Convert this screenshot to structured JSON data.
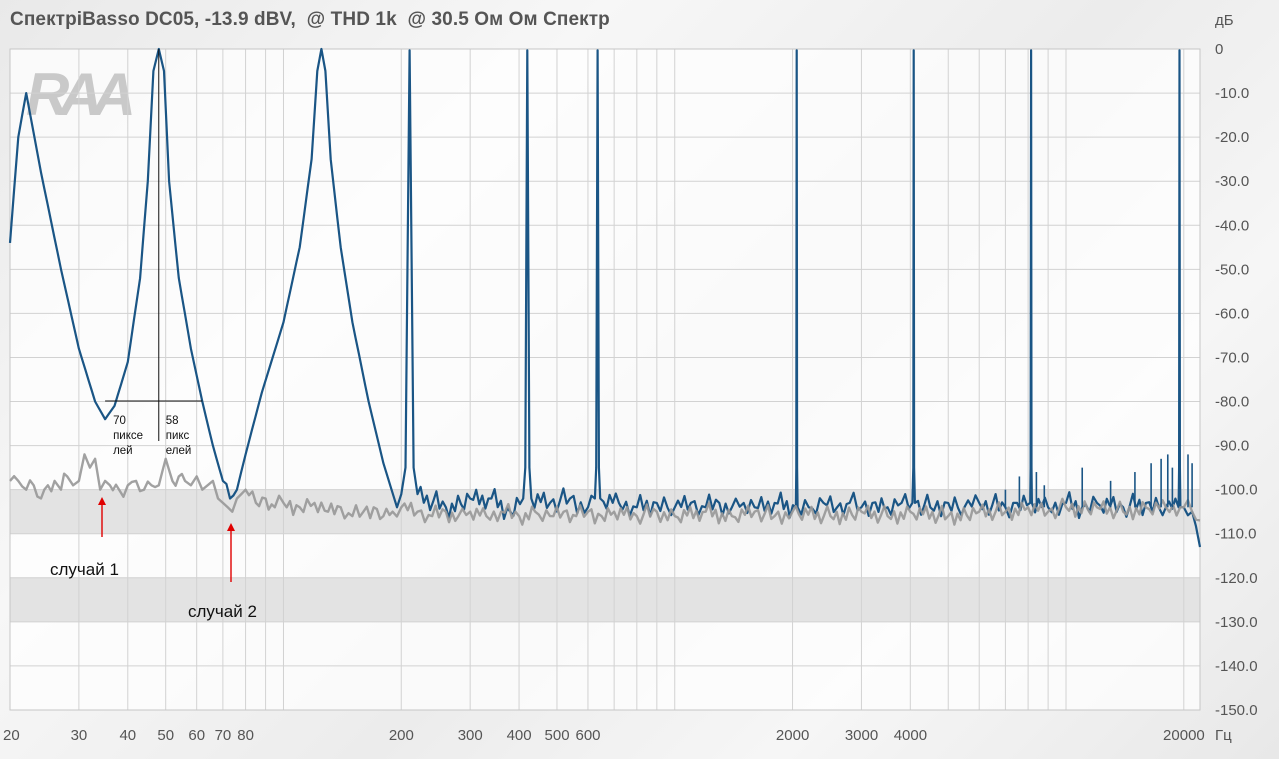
{
  "chart_data": {
    "type": "line",
    "title": "СпектрiBasso DC05, -13.9 dBV,  @ THD 1k  @ 30.5 Ом Ом Спектр",
    "xlabel": "Гц",
    "ylabel": "дБ",
    "x_scale": "log",
    "xlim": [
      20,
      22000
    ],
    "ylim": [
      -150,
      0
    ],
    "x_ticks": [
      {
        "value": 20,
        "label": "20"
      },
      {
        "value": 30,
        "label": "30"
      },
      {
        "value": 40,
        "label": "40"
      },
      {
        "value": 50,
        "label": "50"
      },
      {
        "value": 60,
        "label": "60"
      },
      {
        "value": 70,
        "label": "70"
      },
      {
        "value": 80,
        "label": "80"
      },
      {
        "value": 200,
        "label": "200"
      },
      {
        "value": 300,
        "label": "300"
      },
      {
        "value": 400,
        "label": "400"
      },
      {
        "value": 500,
        "label": "500"
      },
      {
        "value": 600,
        "label": "600"
      },
      {
        "value": 2000,
        "label": "2000"
      },
      {
        "value": 3000,
        "label": "3000"
      },
      {
        "value": 4000,
        "label": "4000"
      },
      {
        "value": 20000,
        "label": "20000"
      }
    ],
    "y_ticks": [
      {
        "value": 0,
        "label": "0"
      },
      {
        "value": -10,
        "label": "-10.0"
      },
      {
        "value": -20,
        "label": "-20.0"
      },
      {
        "value": -30,
        "label": "-30.0"
      },
      {
        "value": -40,
        "label": "-40.0"
      },
      {
        "value": -50,
        "label": "-50.0"
      },
      {
        "value": -60,
        "label": "-60.0"
      },
      {
        "value": -70,
        "label": "-70.0"
      },
      {
        "value": -80,
        "label": "-80.0"
      },
      {
        "value": -90,
        "label": "-90.0"
      },
      {
        "value": -100,
        "label": "-100.0"
      },
      {
        "value": -110,
        "label": "-110.0"
      },
      {
        "value": -120,
        "label": "-120.0"
      },
      {
        "value": -130,
        "label": "-130.0"
      },
      {
        "value": -140,
        "label": "-140.0"
      },
      {
        "value": -150,
        "label": "-150.0"
      }
    ],
    "grid": true,
    "shaded_bands": [
      [
        -110,
        -100
      ],
      [
        -130,
        -120
      ]
    ],
    "series": [
      {
        "color": "#1a5585",
        "points": [
          [
            20,
            -44
          ],
          [
            21,
            -20
          ],
          [
            22,
            -10
          ],
          [
            24,
            -28
          ],
          [
            27,
            -50
          ],
          [
            30,
            -68
          ],
          [
            33,
            -80
          ],
          [
            35,
            -84
          ],
          [
            37,
            -81
          ],
          [
            40,
            -71
          ],
          [
            43,
            -52
          ],
          [
            45,
            -30
          ],
          [
            46.5,
            -5
          ],
          [
            48,
            0
          ],
          [
            49.5,
            -5
          ],
          [
            51,
            -30
          ],
          [
            54,
            -52
          ],
          [
            58,
            -68
          ],
          [
            62,
            -80
          ],
          [
            66,
            -90
          ],
          [
            70,
            -98
          ],
          [
            73,
            -102
          ],
          [
            76,
            -100
          ],
          [
            80,
            -92
          ],
          [
            88,
            -78
          ],
          [
            100,
            -62
          ],
          [
            110,
            -45
          ],
          [
            118,
            -25
          ],
          [
            122,
            -5
          ],
          [
            125,
            0
          ],
          [
            128,
            -5
          ],
          [
            132,
            -25
          ],
          [
            140,
            -45
          ],
          [
            150,
            -62
          ],
          [
            165,
            -80
          ],
          [
            180,
            -94
          ],
          [
            195,
            -104
          ],
          [
            200,
            -101
          ],
          [
            205,
            -95
          ],
          [
            210,
            -0.3
          ],
          [
            215,
            -95
          ],
          [
            220,
            -101
          ],
          [
            260,
            -104
          ],
          [
            300,
            -102
          ],
          [
            340,
            -102
          ],
          [
            380,
            -105
          ],
          [
            410,
            -102
          ],
          [
            415,
            -95
          ],
          [
            420,
            -0.3
          ],
          [
            425,
            -95
          ],
          [
            430,
            -102
          ],
          [
            480,
            -103
          ],
          [
            540,
            -102
          ],
          [
            600,
            -104
          ],
          [
            625,
            -102
          ],
          [
            630,
            -95
          ],
          [
            635,
            -0.3
          ],
          [
            640,
            -95
          ],
          [
            645,
            -102
          ],
          [
            720,
            -103
          ],
          [
            800,
            -104
          ],
          [
            900,
            -103
          ],
          [
            1000,
            -104
          ],
          [
            1100,
            -103
          ],
          [
            1200,
            -104
          ],
          [
            1300,
            -103
          ],
          [
            1400,
            -104
          ],
          [
            1500,
            -103
          ],
          [
            1600,
            -104
          ],
          [
            1800,
            -103
          ],
          [
            2040,
            -104
          ],
          [
            2045,
            -95
          ],
          [
            2050,
            -0.3
          ],
          [
            2055,
            -95
          ],
          [
            2060,
            -104
          ],
          [
            2200,
            -104
          ],
          [
            2400,
            -103
          ],
          [
            2600,
            -104
          ],
          [
            2800,
            -103
          ],
          [
            3000,
            -104
          ],
          [
            3200,
            -103
          ],
          [
            3500,
            -104
          ],
          [
            3800,
            -103
          ],
          [
            4050,
            -103
          ],
          [
            4070,
            -95
          ],
          [
            4080,
            -0.3
          ],
          [
            4090,
            -95
          ],
          [
            4110,
            -103
          ],
          [
            4500,
            -104
          ],
          [
            5000,
            -103
          ],
          [
            5500,
            -104
          ],
          [
            6000,
            -103
          ],
          [
            7000,
            -104
          ],
          [
            7500,
            -103
          ],
          [
            8100,
            -103
          ],
          [
            8120,
            -95
          ],
          [
            8140,
            -0.3
          ],
          [
            8160,
            -95
          ],
          [
            8180,
            -103
          ],
          [
            9000,
            -104
          ],
          [
            10000,
            -103
          ],
          [
            11000,
            -104
          ],
          [
            12000,
            -103
          ],
          [
            14000,
            -104
          ],
          [
            16000,
            -103
          ],
          [
            18000,
            -104
          ],
          [
            19400,
            -104
          ],
          [
            19450,
            -95
          ],
          [
            19500,
            -0.3
          ],
          [
            19550,
            -95
          ],
          [
            19600,
            -104
          ],
          [
            20000,
            -104
          ],
          [
            21000,
            -105
          ],
          [
            22000,
            -113
          ]
        ]
      },
      {
        "color": "#999999",
        "points": [
          [
            20,
            -98
          ],
          [
            21,
            -98
          ],
          [
            22,
            -100
          ],
          [
            23,
            -99
          ],
          [
            24,
            -102
          ],
          [
            25,
            -99
          ],
          [
            26,
            -98
          ],
          [
            27,
            -100
          ],
          [
            28,
            -97
          ],
          [
            29,
            -99
          ],
          [
            30,
            -98
          ],
          [
            31,
            -92
          ],
          [
            32,
            -95
          ],
          [
            33,
            -93
          ],
          [
            34,
            -100
          ],
          [
            35,
            -98
          ],
          [
            36,
            -99
          ],
          [
            38,
            -100
          ],
          [
            40,
            -99
          ],
          [
            42,
            -98
          ],
          [
            44,
            -100
          ],
          [
            46,
            -99
          ],
          [
            48,
            -99
          ],
          [
            50,
            -93
          ],
          [
            52,
            -98
          ],
          [
            54,
            -97
          ],
          [
            56,
            -98
          ],
          [
            58,
            -99
          ],
          [
            60,
            -97
          ],
          [
            62,
            -100
          ],
          [
            64,
            -99
          ],
          [
            66,
            -98
          ],
          [
            68,
            -102
          ],
          [
            70,
            -103
          ],
          [
            72,
            -104
          ],
          [
            74,
            -105
          ],
          [
            76,
            -102
          ],
          [
            78,
            -101
          ],
          [
            80,
            -100
          ],
          [
            85,
            -103
          ],
          [
            90,
            -102
          ],
          [
            95,
            -104
          ],
          [
            100,
            -103
          ],
          [
            110,
            -104
          ],
          [
            120,
            -103
          ],
          [
            130,
            -105
          ],
          [
            140,
            -104
          ],
          [
            150,
            -106
          ],
          [
            160,
            -105
          ],
          [
            170,
            -104
          ],
          [
            180,
            -106
          ],
          [
            190,
            -105
          ],
          [
            200,
            -104
          ],
          [
            220,
            -105
          ],
          [
            240,
            -106
          ],
          [
            260,
            -105
          ],
          [
            280,
            -106
          ],
          [
            300,
            -105
          ],
          [
            330,
            -106
          ],
          [
            360,
            -105
          ],
          [
            400,
            -106
          ],
          [
            440,
            -105
          ],
          [
            480,
            -106
          ],
          [
            520,
            -105
          ],
          [
            560,
            -106
          ],
          [
            600,
            -105
          ],
          [
            650,
            -106
          ],
          [
            700,
            -105
          ],
          [
            800,
            -106
          ],
          [
            900,
            -105
          ],
          [
            1000,
            -106
          ],
          [
            1200,
            -105
          ],
          [
            1400,
            -106
          ],
          [
            1600,
            -105
          ],
          [
            1800,
            -106
          ],
          [
            2000,
            -105
          ],
          [
            2500,
            -106
          ],
          [
            3000,
            -105
          ],
          [
            3500,
            -106
          ],
          [
            4000,
            -105
          ],
          [
            5000,
            -106
          ],
          [
            6000,
            -105
          ],
          [
            7000,
            -105
          ],
          [
            8000,
            -104
          ],
          [
            9000,
            -105
          ],
          [
            10000,
            -104
          ],
          [
            12000,
            -104
          ],
          [
            14000,
            -105
          ],
          [
            16000,
            -104
          ],
          [
            18000,
            -104
          ],
          [
            20000,
            -104
          ],
          [
            21000,
            -105
          ],
          [
            22000,
            -107
          ]
        ]
      }
    ],
    "annotations": {
      "bracket_label_left": [
        "70",
        "пиксе",
        "лей"
      ],
      "bracket_label_right": [
        "58",
        "пикс",
        "елей"
      ],
      "case1": "случай 1",
      "case2": "случай 2"
    }
  },
  "logo": {
    "text": "RAA"
  },
  "colors": {
    "annotation_arrow": "#e00000",
    "band": "#dedede",
    "grid": "#d2d2d2"
  }
}
